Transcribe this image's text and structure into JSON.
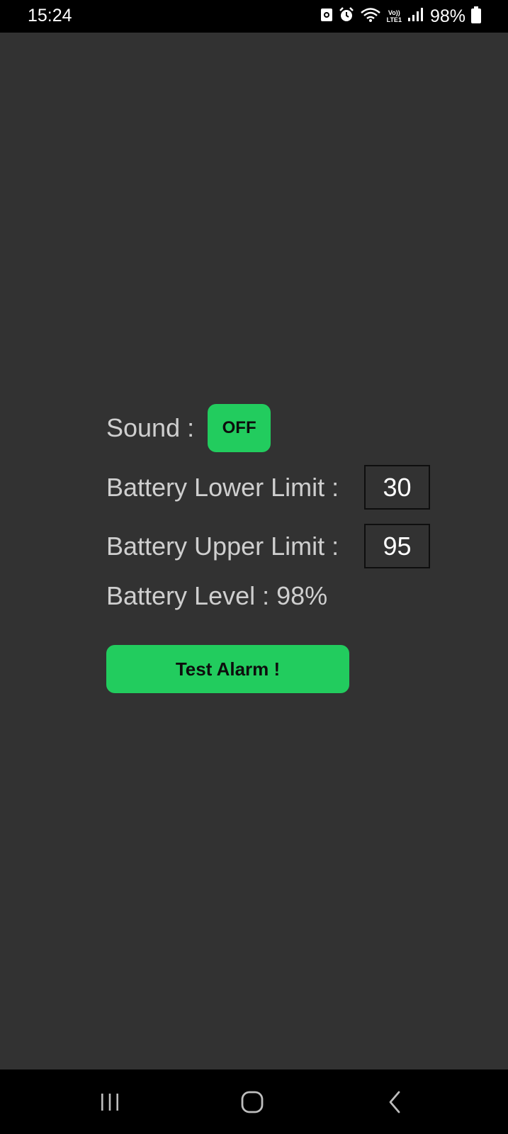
{
  "status_bar": {
    "time": "15:24",
    "battery_percent": "98%",
    "network_label_top": "Vo))",
    "network_label_bottom": "LTE1",
    "icons": [
      "shield-icon",
      "alarm-icon",
      "wifi-icon",
      "lte-icon",
      "signal-icon",
      "battery-icon"
    ]
  },
  "settings": {
    "sound_label": "Sound :",
    "sound_state": "OFF",
    "lower_limit_label": "Battery Lower Limit :",
    "lower_limit_value": "30",
    "upper_limit_label": "Battery Upper Limit :",
    "upper_limit_value": "95",
    "battery_level_text": "Battery Level : 98%"
  },
  "actions": {
    "test_alarm_label": "Test Alarm !"
  },
  "nav_bar": {
    "icons": [
      "recents-icon",
      "home-icon",
      "back-icon"
    ]
  },
  "colors": {
    "background": "#323232",
    "accent": "#22cc5e",
    "text": "#cfcfcf"
  }
}
